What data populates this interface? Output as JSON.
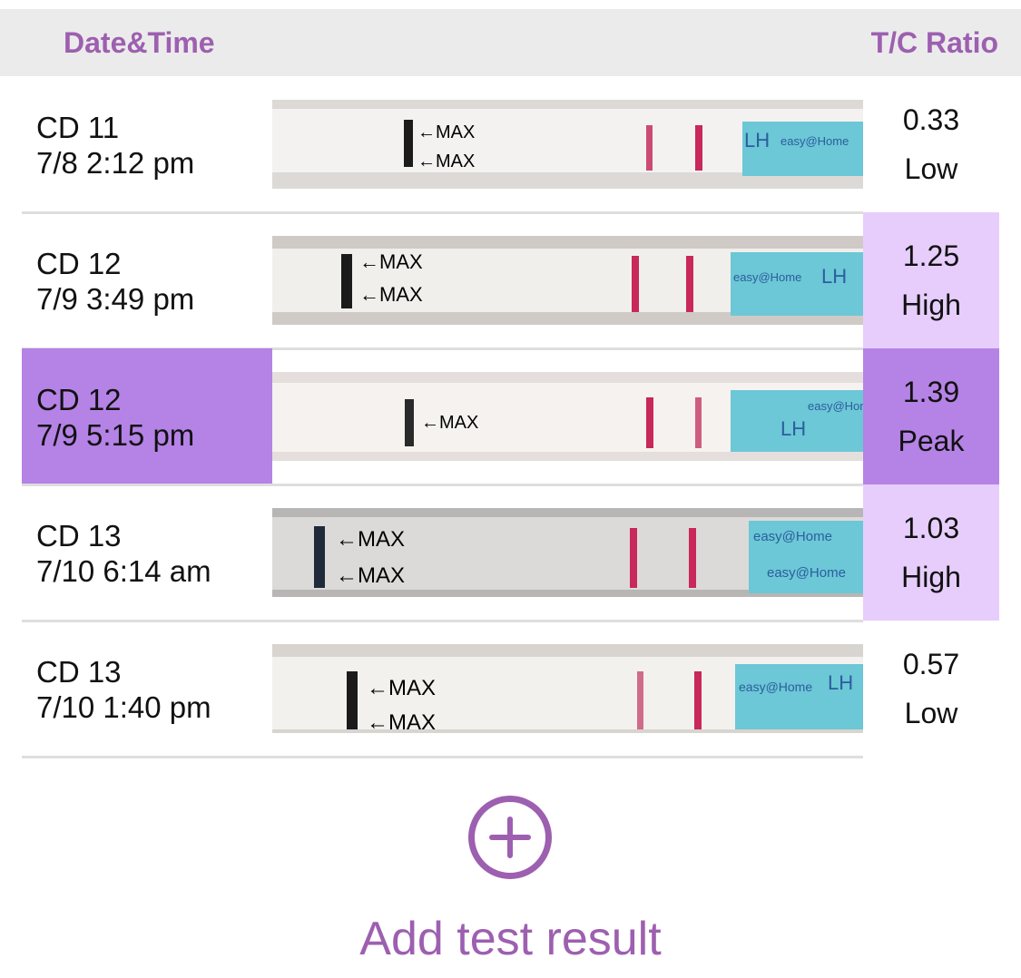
{
  "header": {
    "date_label": "Date&Time",
    "ratio_label": "T/C Ratio"
  },
  "strip_text": {
    "max_label": "←MAX",
    "lh": "LH",
    "brand": "easy@Home"
  },
  "rows": [
    {
      "cd": "CD 11",
      "datetime": "7/8 2:12 pm",
      "ratio": "0.33",
      "level": "Low",
      "selected": false
    },
    {
      "cd": "CD 12",
      "datetime": "7/9 3:49 pm",
      "ratio": "1.25",
      "level": "High",
      "selected": false
    },
    {
      "cd": "CD 12",
      "datetime": "7/9 5:15 pm",
      "ratio": "1.39",
      "level": "Peak",
      "selected": true
    },
    {
      "cd": "CD 13",
      "datetime": "7/10 6:14 am",
      "ratio": "1.03",
      "level": "High",
      "selected": false
    },
    {
      "cd": "CD 13",
      "datetime": "7/10 1:40 pm",
      "ratio": "0.57",
      "level": "Low",
      "selected": false
    }
  ],
  "add": {
    "label": "Add test result",
    "icon": "plus-circle-icon"
  },
  "colors": {
    "accent": "#9d5fb0",
    "peak_bg": "#b582e6",
    "high_bg": "#e7cdfc",
    "header_bg": "#ebebeb",
    "strip_blue": "#6cc7d6",
    "line_red": "#c8285a"
  }
}
